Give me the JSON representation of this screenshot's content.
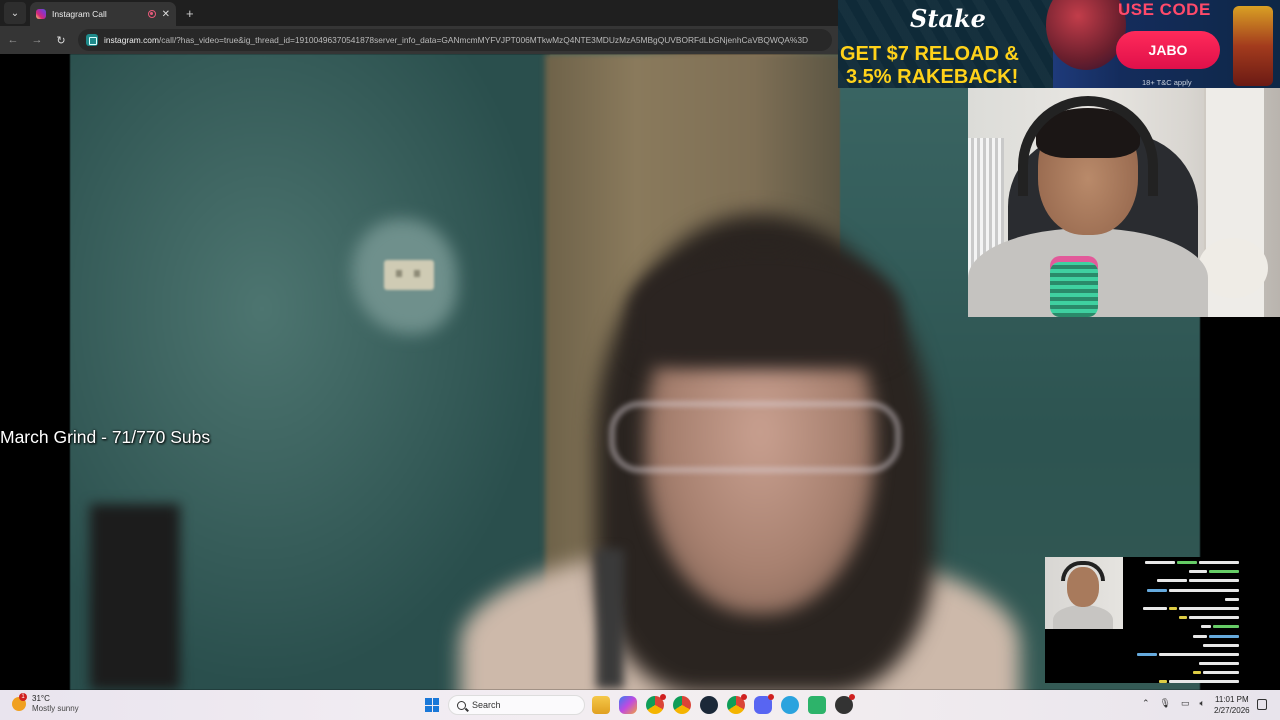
{
  "browser": {
    "tab": {
      "title": "Instagram Call"
    },
    "address": {
      "host": "instagram.com",
      "path": "/call/?has_video=true&ig_thread_id=19100496370541878server_info_data=GANmcmMYFVJPT006MTkwMzQ4NTE3MDUzMzA5MBgQUVBORFdLbGNjenhCaVBQWQA%3D"
    }
  },
  "stream_overlay": {
    "goal_text": "March Grind - 71/770 Subs"
  },
  "ad_banner": {
    "brand": "Stake",
    "headline_1": "GET $7 RELOAD &",
    "headline_2": "3.5% RAKEBACK!",
    "use_code_label": "USE CODE",
    "code": "JABO",
    "disclaimer": "18+ T&C apply",
    "colors": {
      "headline": "#ffd21a",
      "code_button": "#ff2a5a"
    }
  },
  "taskbar": {
    "weather_temp": "31°C",
    "weather_desc": "Mostly sunny",
    "weather_badge": "1",
    "search_label": "Search",
    "icons": [
      "file-explorer-icon",
      "copilot-icon",
      "chrome-icon",
      "chrome-icon",
      "steam-icon",
      "chrome-icon",
      "discord-icon",
      "telegram-icon",
      "app-icon",
      "app-icon"
    ],
    "time": "11:01 PM",
    "date": "2/27/2026"
  }
}
